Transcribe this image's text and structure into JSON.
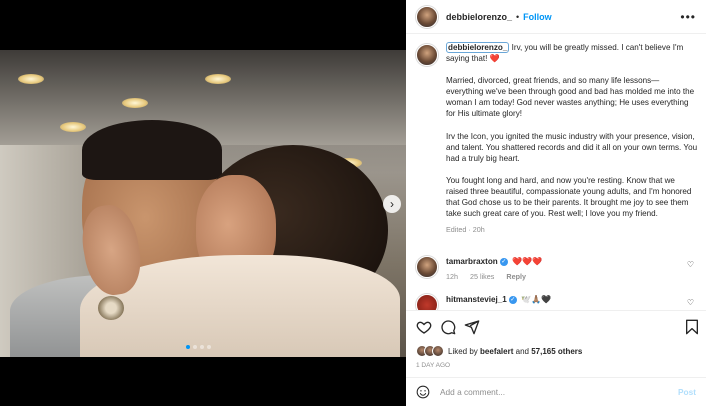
{
  "post": {
    "author": "debbielorenzo_",
    "separator": "•",
    "follow_label": "Follow",
    "more_icon": "more-horizontal-icon",
    "carousel_next_icon": "chevron-right-icon",
    "carousel_dots": 4,
    "carousel_active_index": 0,
    "caption_first_line": "Irv, you will be greatly missed. I can't believe I'm saying that! ❤️",
    "caption_paragraphs": [
      "Married, divorced, great friends, and so many life lessons— everything we've been through good and bad has molded me into the woman I am today! God never wastes anything; He uses everything for His ultimate glory!",
      "Irv the Icon, you ignited the music industry with your presence, vision, and talent. You shattered records and did it all on your own terms. You had a truly big heart.",
      "You fought long and hard, and now you're resting. Know that we raised three beautiful, compassionate young adults, and I'm honored that God chose us to be their parents. It brought me joy to see them take such great care of you. Rest well; I love you my friend."
    ],
    "edited_label": "Edited",
    "edited_time": "20h"
  },
  "comments": [
    {
      "user": "tamarbraxton",
      "verified": true,
      "text": "❤️❤️❤️",
      "time": "12h",
      "likes": "25 likes",
      "reply_label": "Reply"
    },
    {
      "user": "hitmansteviej_1",
      "verified": true,
      "text": "🕊️🙏🏽🖤",
      "time": "",
      "likes": "",
      "reply_label": ""
    }
  ],
  "actions": {
    "icons": [
      "heart-icon",
      "comment-icon",
      "share-icon",
      "bookmark-icon"
    ],
    "liked_by_prefix": "Liked by",
    "liked_by_user": "beefalert",
    "liked_by_and": "and",
    "liked_by_count": "57,165 others",
    "time_ago": "1 DAY AGO"
  },
  "comment_box": {
    "placeholder": "Add a comment...",
    "post_label": "Post"
  },
  "colors": {
    "link_blue": "#0095f6",
    "verified_blue": "#3897f0",
    "heart_red": "#ed4956",
    "muted_gray": "#8e8e8e"
  }
}
